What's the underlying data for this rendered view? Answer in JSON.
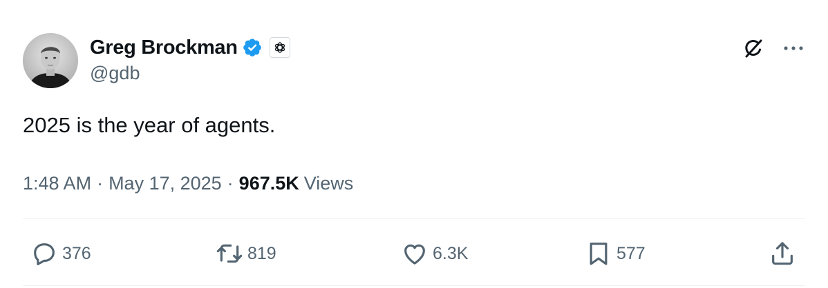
{
  "author": {
    "name": "Greg Brockman",
    "handle": "@gdb",
    "verified": true,
    "affiliation_icon": "openai-logo-icon"
  },
  "header_actions": {
    "grok_icon": "grok-icon",
    "more_icon": "more-dots-icon"
  },
  "tweet": {
    "text": "2025 is the year of agents."
  },
  "meta": {
    "time": "1:48 AM",
    "separator": "·",
    "date": "May 17, 2025",
    "views_count": "967.5K",
    "views_label": "Views"
  },
  "actions": {
    "replies": "376",
    "retweets": "819",
    "likes": "6.3K",
    "bookmarks": "577"
  },
  "colors": {
    "text_primary": "#0f1419",
    "text_secondary": "#536471",
    "verified_blue": "#1d9bf0",
    "divider": "#eff3f4"
  }
}
